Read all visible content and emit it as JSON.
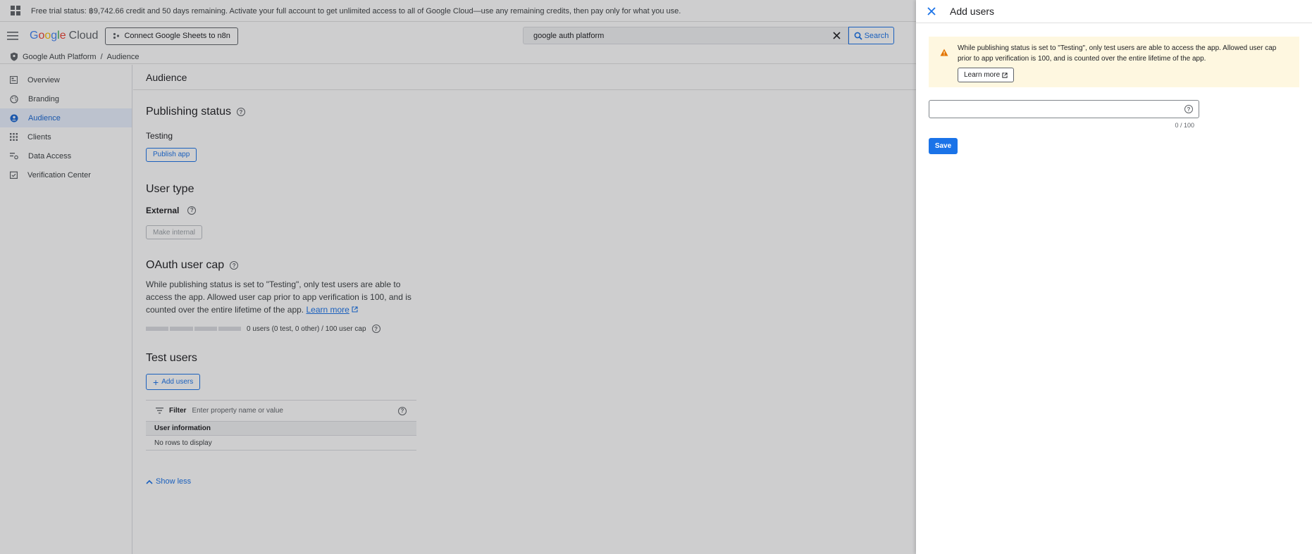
{
  "trial_bar": {
    "message": "Free trial status: ฿9,742.66 credit and 50 days remaining. Activate your full account to get unlimited access to all of Google Cloud—use any remaining credits, then pay only for what you use."
  },
  "topbar": {
    "logo_google": [
      "G",
      "o",
      "o",
      "g",
      "l",
      "e"
    ],
    "logo_cloud": "Cloud",
    "project_label": "Connect Google Sheets to n8n",
    "search_value": "google auth platform",
    "search_button": "Search"
  },
  "breadcrumb": {
    "items": [
      "Google Auth Platform",
      "/",
      "Audience"
    ]
  },
  "sidebar": {
    "items": [
      {
        "label": "Overview",
        "icon": "dashboard-icon",
        "active": false
      },
      {
        "label": "Branding",
        "icon": "palette-icon",
        "active": false
      },
      {
        "label": "Audience",
        "icon": "account-circle-icon",
        "active": true
      },
      {
        "label": "Clients",
        "icon": "grid-icon",
        "active": false
      },
      {
        "label": "Data Access",
        "icon": "data-access-icon",
        "active": false
      },
      {
        "label": "Verification Center",
        "icon": "verified-icon",
        "active": false
      }
    ]
  },
  "main": {
    "header": "Audience",
    "publishing": {
      "title": "Publishing status",
      "status": "Testing",
      "button": "Publish app"
    },
    "user_type": {
      "title": "User type",
      "value": "External",
      "button": "Make internal"
    },
    "cap": {
      "title": "OAuth user cap",
      "paragraph": "While publishing status is set to \"Testing\", only test users are able to access the app. Allowed user cap prior to app verification is 100, and is counted over the entire lifetime of the app.",
      "learn_more": "Learn more",
      "usage_text": "0 users (0 test, 0 other) / 100 user cap",
      "usage_fraction": 0
    },
    "test_users": {
      "title": "Test users",
      "add_button": "Add users",
      "filter_label": "Filter",
      "filter_placeholder": "Enter property name or value",
      "column_header": "User information",
      "empty_text": "No rows to display"
    },
    "show_less": "Show less"
  },
  "panel": {
    "title": "Add users",
    "warning_text": "While publishing status is set to \"Testing\", only test users are able to access the app. Allowed user cap prior to app verification is 100, and is counted over the entire lifetime of the app.",
    "learn_more": "Learn more",
    "input_value": "",
    "counter": "0 / 100",
    "save_button": "Save"
  },
  "colors": {
    "accent": "#1a73e8",
    "warning_bg": "#fef7e0",
    "warning_icon": "#e37400"
  }
}
